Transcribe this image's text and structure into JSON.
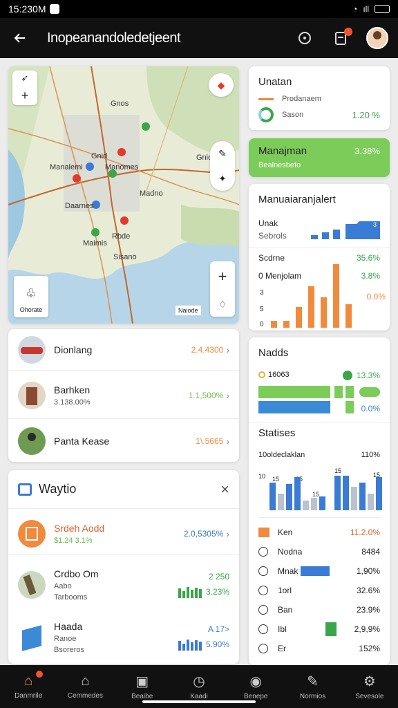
{
  "status": {
    "time": "15:230M",
    "signal": "ıll"
  },
  "app": {
    "title": "Inopeanandoledetjeent"
  },
  "map": {
    "labels": [
      "Gnos",
      "Gnid",
      "Manalemi",
      "Manomes",
      "Madno",
      "Gnid",
      "Daarnes",
      "Maimis",
      "Rbde",
      "Sisano"
    ],
    "legend_label": "Ohorate",
    "scale_label": "Naiode"
  },
  "places": [
    {
      "name": "Dionlang",
      "sub": "",
      "value": "2.4.4300",
      "color": "#f28a3d"
    },
    {
      "name": "Barhken",
      "sub": "3.138.00%",
      "value": "1.1,500%",
      "color": "#6bbf4a"
    },
    {
      "name": "Panta Kease",
      "sub": "",
      "value": "1\\.5665",
      "color": "#f28a3d"
    }
  ],
  "waytio": {
    "title": "Waytio",
    "rows": [
      {
        "name": "Srdeh Aodd",
        "sub": "$1.24 3.1%",
        "sub2": "",
        "top": "",
        "value": "2.0,5305%"
      },
      {
        "name": "Crdbo Om",
        "sub": "Aabo",
        "sub2": "Tarbooms",
        "top": "2    250",
        "value": "3.23%"
      },
      {
        "name": "Haada",
        "sub": "Ranoe",
        "sub2": "Bsoreros",
        "top": "A    17>",
        "value": "5.90%"
      }
    ]
  },
  "overview": {
    "title": "Unatan",
    "row1": "Prodanaem",
    "row2": "Sason",
    "value": "1.20 %"
  },
  "manajman": {
    "title": "Manajman",
    "sub": "Bealnesbeto",
    "value": "3.38%"
  },
  "panel3": {
    "title": "Manuaiaranjalert",
    "lines": [
      {
        "label": "Unak",
        "value": ""
      },
      {
        "label": "Sebrols",
        "value": ""
      },
      {
        "label": "Scdrne",
        "value": "35.6%"
      },
      {
        "label": "0  Menjolam",
        "value": "3.8%"
      },
      {
        "label": "",
        "value": "0.0%"
      }
    ],
    "axis": [
      "3",
      "5",
      "0"
    ],
    "top_tag": "3"
  },
  "nodes": {
    "title": "Nadds",
    "row1_label": "16063",
    "row1_value": "13.3%",
    "row2_value": "0.0%"
  },
  "stats": {
    "title": "Statises",
    "sub": "10oldeclaklan",
    "sub_value": "110%",
    "chart_labels": [
      "10",
      "15",
      "15",
      "15",
      "15",
      "15"
    ],
    "rows": [
      {
        "label": "Ken",
        "value": "11.2.0%"
      },
      {
        "label": "Nodna",
        "value": "8484"
      },
      {
        "label": "Mnak",
        "value": "1,90%"
      },
      {
        "label": "1orl",
        "value": "32.6%"
      },
      {
        "label": "Ban",
        "value": "23.9%"
      },
      {
        "label": "Ibl",
        "value": "2,9,9%"
      },
      {
        "label": "Er",
        "value": "152%"
      }
    ]
  },
  "nav": [
    "Danmrile",
    "Cemmedes",
    "Beaibe",
    "Kaadi",
    "Benepe",
    "Normios",
    "Sevesole"
  ],
  "colors": {
    "accent": "#f28a3d",
    "green": "#6bbf4a",
    "blue": "#3a7bd5",
    "bar": "#111111"
  }
}
